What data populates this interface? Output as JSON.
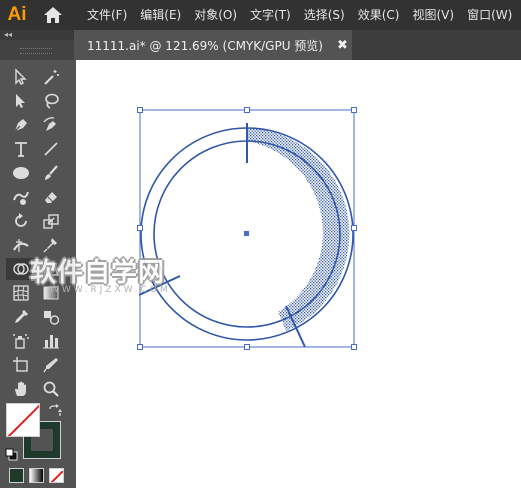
{
  "app": {
    "logo_text": "Ai"
  },
  "menu": [
    {
      "label": "文件(F)"
    },
    {
      "label": "编辑(E)"
    },
    {
      "label": "对象(O)"
    },
    {
      "label": "文字(T)"
    },
    {
      "label": "选择(S)"
    },
    {
      "label": "效果(C)"
    },
    {
      "label": "视图(V)"
    },
    {
      "label": "窗口(W)"
    }
  ],
  "panel": {
    "collapse_glyph": "◂◂"
  },
  "document": {
    "tab_title": "11111.ai* @ 121.69% (CMYK/GPU 预览)",
    "close_glyph": "✖"
  },
  "tools": [
    {
      "icon": "selection-tool-icon"
    },
    {
      "icon": "magic-wand-icon"
    },
    {
      "icon": "direct-selection-icon"
    },
    {
      "icon": "lasso-icon"
    },
    {
      "icon": "pen-tool-icon"
    },
    {
      "icon": "curvature-tool-icon"
    },
    {
      "icon": "type-tool-icon"
    },
    {
      "icon": "line-segment-icon"
    },
    {
      "icon": "ellipse-tool-icon"
    },
    {
      "icon": "paintbrush-icon"
    },
    {
      "icon": "shaper-tool-icon"
    },
    {
      "icon": "eraser-icon"
    },
    {
      "icon": "rotate-tool-icon"
    },
    {
      "icon": "scale-tool-icon"
    },
    {
      "icon": "width-tool-icon"
    },
    {
      "icon": "puppet-warp-icon"
    },
    {
      "icon": "shape-builder-icon"
    },
    {
      "icon": "perspective-grid-icon"
    },
    {
      "icon": "mesh-tool-icon"
    },
    {
      "icon": "gradient-tool-icon"
    },
    {
      "icon": "eyedropper-icon"
    },
    {
      "icon": "blend-tool-icon"
    },
    {
      "icon": "symbol-sprayer-icon"
    },
    {
      "icon": "column-graph-icon"
    },
    {
      "icon": "artboard-tool-icon"
    },
    {
      "icon": "slice-tool-icon"
    },
    {
      "icon": "hand-tool-icon"
    },
    {
      "icon": "zoom-tool-icon"
    }
  ],
  "colors": {
    "accent_logo": "#ff9a00",
    "fill": "#ffffff",
    "stroke": "#1f3a2c",
    "selection": "#4a6cc8",
    "artwork_stroke": "#2f56a8"
  },
  "watermark": {
    "title": "软件自学网",
    "url": "WWW.RJZXW.COM"
  }
}
